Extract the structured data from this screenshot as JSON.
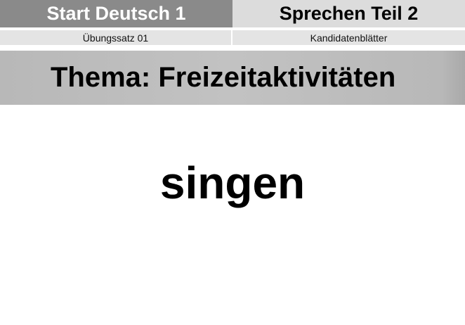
{
  "header": {
    "left_title": "Start Deutsch 1",
    "right_title": "Sprechen Teil 2"
  },
  "subheader": {
    "left_label": "Übungssatz 01",
    "right_label": "Kandidatenblätter"
  },
  "thema": {
    "text": "Thema: Freizeitaktivitäten"
  },
  "card": {
    "word": "singen"
  },
  "colors": {
    "header_left_bg": "#8a8a8a",
    "header_right_bg": "#dcdcdc",
    "subheader_bg": "#e4e4e4",
    "thema_bg": "#bdbdbd",
    "text": "#000000"
  }
}
